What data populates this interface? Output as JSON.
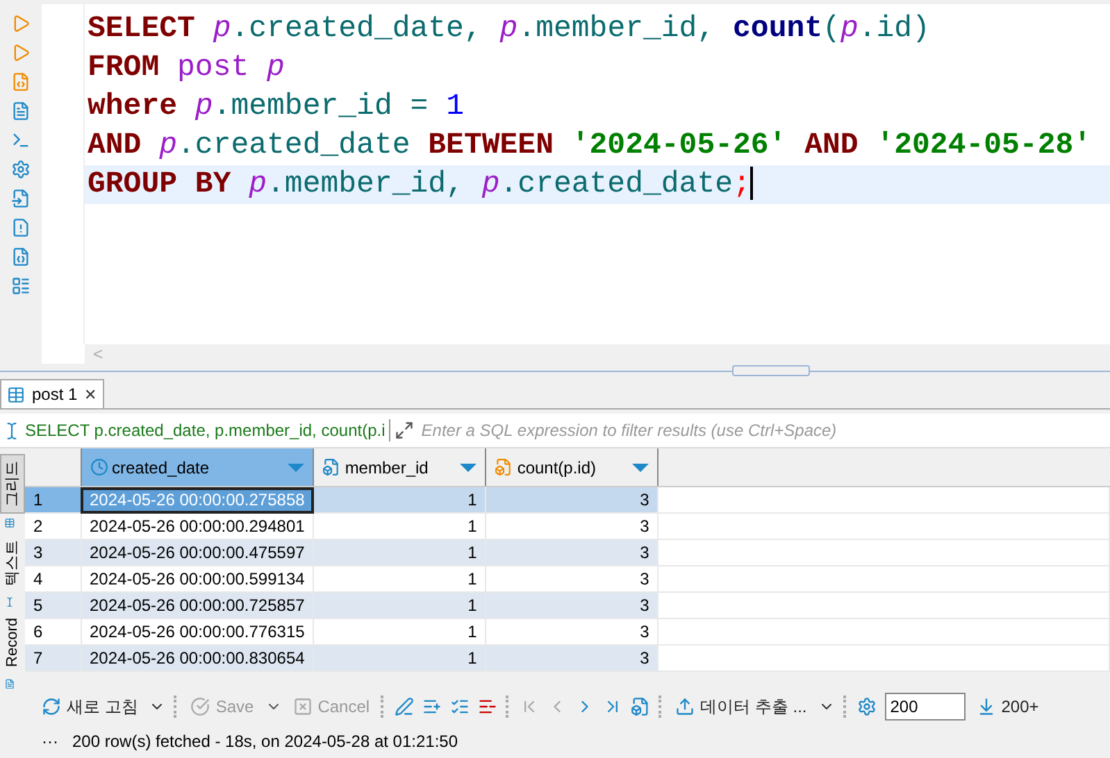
{
  "editor": {
    "lines": [
      {
        "current": false,
        "tokens": [
          {
            "kind": "keyword",
            "text": "SELECT "
          },
          {
            "kind": "alias",
            "text": "p"
          },
          {
            "kind": "ident",
            "text": ".created_date, "
          },
          {
            "kind": "alias",
            "text": "p"
          },
          {
            "kind": "ident",
            "text": ".member_id, "
          },
          {
            "kind": "func",
            "text": "count"
          },
          {
            "kind": "ident",
            "text": "("
          },
          {
            "kind": "alias",
            "text": "p"
          },
          {
            "kind": "ident",
            "text": ".id)"
          }
        ]
      },
      {
        "current": false,
        "tokens": [
          {
            "kind": "keyword",
            "text": "FROM "
          },
          {
            "kind": "table",
            "text": "post "
          },
          {
            "kind": "alias",
            "text": "p"
          }
        ]
      },
      {
        "current": false,
        "tokens": [
          {
            "kind": "keyword",
            "text": "where "
          },
          {
            "kind": "alias",
            "text": "p"
          },
          {
            "kind": "ident",
            "text": ".member_id = "
          },
          {
            "kind": "number",
            "text": "1"
          }
        ]
      },
      {
        "current": false,
        "tokens": [
          {
            "kind": "keyword",
            "text": "AND "
          },
          {
            "kind": "alias",
            "text": "p"
          },
          {
            "kind": "ident",
            "text": ".created_date "
          },
          {
            "kind": "keyword",
            "text": "BETWEEN "
          },
          {
            "kind": "string",
            "text": "'2024-05-26' "
          },
          {
            "kind": "keyword",
            "text": "AND "
          },
          {
            "kind": "string",
            "text": "'2024-05-28'"
          }
        ]
      },
      {
        "current": true,
        "tokens": [
          {
            "kind": "keyword",
            "text": "GROUP BY "
          },
          {
            "kind": "alias",
            "text": "p"
          },
          {
            "kind": "ident",
            "text": ".member_id, "
          },
          {
            "kind": "alias",
            "text": "p"
          },
          {
            "kind": "ident",
            "text": ".created_date"
          },
          {
            "kind": "semicolon",
            "text": ";"
          }
        ]
      }
    ],
    "scroll_left": "<"
  },
  "results_tab": {
    "label": "post 1",
    "close": "✕",
    "selected": true
  },
  "filter": {
    "query": "SELECT p.created_date, p.member_id, count(p.i",
    "placeholder": "Enter a SQL expression to filter results (use Ctrl+Space)"
  },
  "side_tabs": [
    {
      "label": "그리드",
      "kind": "grid",
      "selected": true
    },
    {
      "label": "텍스트",
      "kind": "text",
      "selected": false
    },
    {
      "label": "Record",
      "kind": "record",
      "selected": false
    }
  ],
  "table": {
    "columns": [
      {
        "label": "created_date",
        "kind": "datetime",
        "selected": true
      },
      {
        "label": "member_id",
        "kind": "number",
        "selected": false
      },
      {
        "label": "count(p.id)",
        "kind": "calc",
        "selected": false
      }
    ],
    "rows": [
      {
        "number": "1",
        "cells": [
          "2024-05-26 00:00:00.275858",
          "1",
          "3"
        ],
        "selected": true
      },
      {
        "number": "2",
        "cells": [
          "2024-05-26 00:00:00.294801",
          "1",
          "3"
        ],
        "selected": false
      },
      {
        "number": "3",
        "cells": [
          "2024-05-26 00:00:00.475597",
          "1",
          "3"
        ],
        "selected": false
      },
      {
        "number": "4",
        "cells": [
          "2024-05-26 00:00:00.599134",
          "1",
          "3"
        ],
        "selected": false
      },
      {
        "number": "5",
        "cells": [
          "2024-05-26 00:00:00.725857",
          "1",
          "3"
        ],
        "selected": false
      },
      {
        "number": "6",
        "cells": [
          "2024-05-26 00:00:00.776315",
          "1",
          "3"
        ],
        "selected": false
      },
      {
        "number": "7",
        "cells": [
          "2024-05-26 00:00:00.830654",
          "1",
          "3"
        ],
        "selected": false
      }
    ]
  },
  "toolbar": {
    "refresh": "새로 고침",
    "save": {
      "label": "Save",
      "disabled": true
    },
    "cancel": {
      "label": "Cancel",
      "disabled": true
    },
    "export": "데이터 추출 ...",
    "fetch_size": "200",
    "fetch_more": "200+"
  },
  "status": {
    "more": "···",
    "text": "200 row(s) fetched - 18s, on 2024-05-28 at 01:21:50"
  }
}
